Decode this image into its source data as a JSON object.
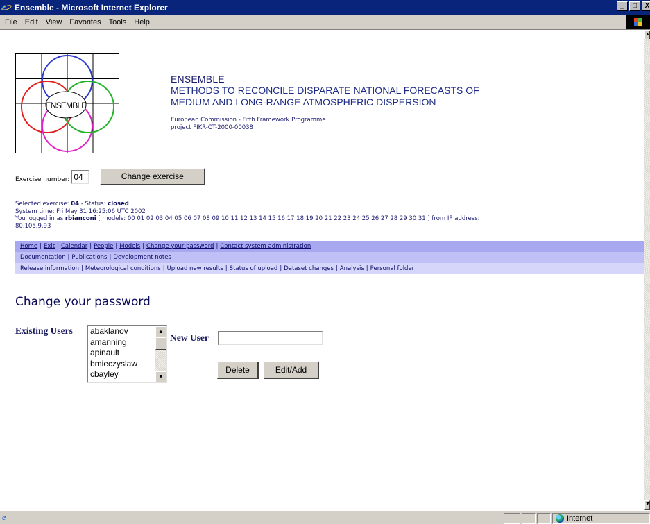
{
  "window": {
    "title": "Ensemble - Microsoft Internet Explorer",
    "buttons": [
      "_",
      "□",
      "X"
    ]
  },
  "menu": {
    "items": [
      "File",
      "Edit",
      "View",
      "Favorites",
      "Tools",
      "Help"
    ]
  },
  "logo": {
    "text": "ENSEMBLE",
    "colors": {
      "blue_circle": "#2b3ad0",
      "purple_circle": "#9a2ad8",
      "red_circle": "#e02020",
      "green_circle": "#22b22a",
      "magenta_circle": "#e020c8"
    }
  },
  "header": {
    "name": "ENSEMBLE",
    "subtitle_line1": "METHODS TO RECONCILE DISPARATE NATIONAL FORECASTS OF",
    "subtitle_line2": "MEDIUM AND LONG-RANGE ATMOSPHERIC DISPERSION",
    "funding": "European Commission - Fifth Framework Programme",
    "project": "project FIKR-CT-2000-00038"
  },
  "exercise": {
    "label": "Exercise number:",
    "value": "04",
    "button": "Change exercise"
  },
  "status": {
    "selected_prefix": "Selected exercise: ",
    "selected_value": "04",
    "status_prefix": " - Status: ",
    "status_value": "closed",
    "system_time": "System time: Fri May 31 16:25:06 UTC 2002",
    "login_prefix": "You logged in as ",
    "login_user": "rbianconi",
    "login_suffix": " [ models: 00 01 02 03 04 05 06 07 08 09 10 11 12 13 14 15 16 17 18 19 20 21 22 23 24 25 26 27 28 29 30 31 ] from IP address:",
    "ip": "80.105.9.93"
  },
  "nav": {
    "row1": [
      "Home",
      "Exit",
      "Calendar",
      "People",
      "Models",
      "Change your password",
      "Contact system administration"
    ],
    "row2": [
      "Documentation",
      "Publications",
      "Development notes"
    ],
    "row3": [
      "Release information",
      "Meteorological conditions",
      "Upload new results",
      "Status of upload",
      "Dataset changes",
      "Analysis",
      "Personal folder"
    ]
  },
  "main": {
    "title": "Change your password",
    "existing_users_label": "Existing Users",
    "users": [
      "abaklanov",
      "amanning",
      "apinault",
      "bmieczyslaw",
      "cbayley"
    ],
    "new_user_label": "New User",
    "new_user_value": "",
    "delete_button": "Delete",
    "edit_button": "Edit/Add"
  },
  "statusbar": {
    "zone": "Internet"
  },
  "colors": {
    "titlebar": "#08247b",
    "nav_row1": "#a8a8f0",
    "nav_row2": "#c0c0f6",
    "nav_row3": "#d6d6fa",
    "text_navy": "#1a1a6e",
    "chrome": "#d4d0c8"
  }
}
